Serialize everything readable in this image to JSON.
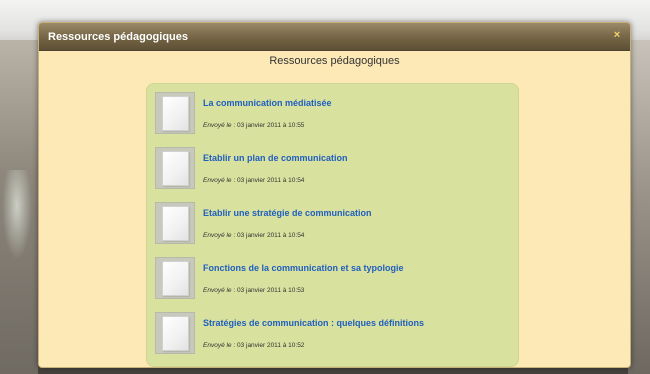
{
  "window": {
    "title": "Ressources pédagogiques",
    "close_icon": "×"
  },
  "heading": "Ressources pédagogiques",
  "resources": [
    {
      "title": "La communication médiatisée",
      "sent_label": "Envoyé le",
      "date": " : 03 janvier 2011 à 10:55"
    },
    {
      "title": "Etablir un plan de communication",
      "sent_label": "Envoyé le",
      "date": " : 03 janvier 2011 à 10:54"
    },
    {
      "title": "Etablir une stratégie de communication",
      "sent_label": "Envoyé le",
      "date": " : 03 janvier 2011 à 10:54"
    },
    {
      "title": "Fonctions de la communication et sa typologie",
      "sent_label": "Envoyé le",
      "date": " : 03 janvier 2011 à 10:53"
    },
    {
      "title": "Stratégies de communication : quelques définitions",
      "sent_label": "Envoyé le",
      "date": " : 03 janvier 2011 à 10:52"
    }
  ],
  "colors": {
    "modal_bg": "#fde9b6",
    "panel_bg": "#d9e19e",
    "link": "#1f5fbf",
    "titlebar": "#7a6a4a"
  }
}
